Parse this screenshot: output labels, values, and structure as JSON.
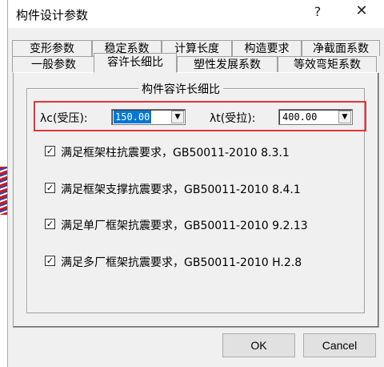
{
  "window": {
    "title": "构件设计参数",
    "help": "?",
    "close": "✕"
  },
  "tabs_row1": [
    "变形参数",
    "稳定系数",
    "计算长度",
    "构造要求",
    "净截面系数"
  ],
  "tabs_row2": [
    "一般参数",
    "容许长细比",
    "塑性发展系数",
    "等效弯矩系数"
  ],
  "active_tab": "容许长细比",
  "group": {
    "title": "构件容许长细比",
    "compression": {
      "label": "λc(受压):",
      "value": "150.00"
    },
    "tension": {
      "label": "λt(受拉):",
      "value": "400.00"
    }
  },
  "checks": [
    {
      "label": "满足框架柱抗震要求，GB50011-2010 8.3.1",
      "checked": true
    },
    {
      "label": "满足框架支撑抗震要求，GB50011-2010 8.4.1",
      "checked": true
    },
    {
      "label": "满足单厂框架抗震要求，GB50011-2010 9.2.13",
      "checked": true
    },
    {
      "label": "满足多厂框架抗震要求，GB50011-2010 H.2.8",
      "checked": true
    }
  ],
  "buttons": {
    "ok": "OK",
    "cancel": "Cancel"
  },
  "colors": {
    "highlight": "#e0363a",
    "selection": "#0078d7"
  }
}
